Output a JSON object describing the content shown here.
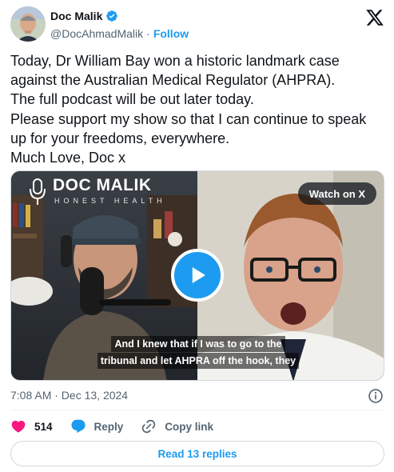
{
  "author": {
    "display_name": "Doc Malik",
    "handle": "@DocAhmadMalik",
    "separator": "·",
    "follow_label": "Follow"
  },
  "tweet": {
    "text": "Today, Dr William Bay won a historic landmark case against the Australian Medical Regulator (AHPRA).\nThe full podcast will be out later today.\nPlease support my show so that I can continue to speak up for your freedoms, everywhere.\nMuch Love, Doc x"
  },
  "media": {
    "watch_label": "Watch on X",
    "logo_title": "DOC MALIK",
    "logo_subtitle": "HONEST HEALTH",
    "caption_line1": "And I knew that if I was to go to the",
    "caption_line2": "tribunal and let AHPRA off the hook, they"
  },
  "meta": {
    "timestamp": "7:08 AM · Dec 13, 2024"
  },
  "actions": {
    "like_count": "514",
    "reply_label": "Reply",
    "copy_link_label": "Copy link"
  },
  "replies_button": {
    "label": "Read 13 replies"
  },
  "colors": {
    "accent": "#1d9bf0",
    "like": "#f91880",
    "text": "#0f1419",
    "secondary": "#536471"
  }
}
